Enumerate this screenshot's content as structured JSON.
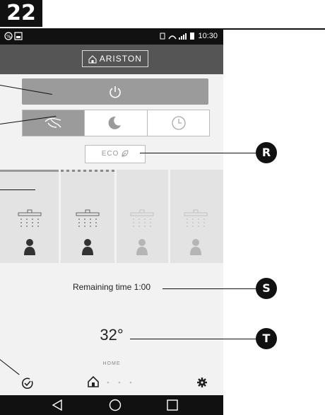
{
  "figure_number": "22",
  "status_bar": {
    "time": "10:30"
  },
  "app": {
    "brand": "ARISTON"
  },
  "eco_label": "ECO",
  "remaining_time": "Remaining time 1:00",
  "temperature": "32°",
  "nav_label": "HOME",
  "callouts": [
    "R",
    "S",
    "T"
  ]
}
